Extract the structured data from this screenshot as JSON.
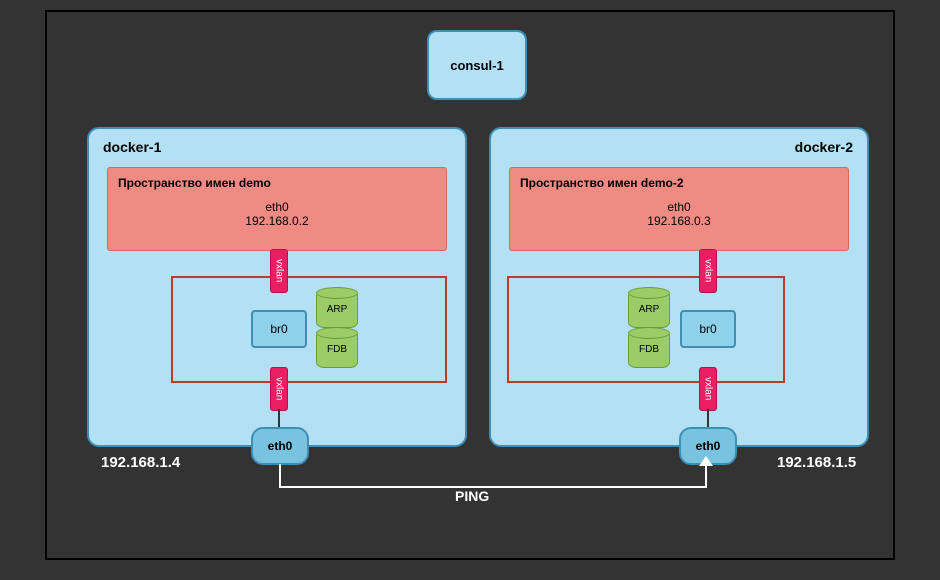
{
  "consul": {
    "label": "consul-1"
  },
  "docker1": {
    "title": "docker-1",
    "namespace": {
      "title": "Пространство имен demo",
      "iface": "eth0",
      "ip": "192.168.0.2"
    },
    "vxlan": "vxlan",
    "br0": "br0",
    "db": {
      "arp": "ARP",
      "fdb": "FDB"
    },
    "eth0": "eth0",
    "host_ip": "192.168.1.4"
  },
  "docker2": {
    "title": "docker-2",
    "namespace": {
      "title": "Пространство имен demo-2",
      "iface": "eth0",
      "ip": "192.168.0.3"
    },
    "vxlan": "vxlan",
    "br0": "br0",
    "db": {
      "arp": "ARP",
      "fdb": "FDB"
    },
    "eth0": "eth0",
    "host_ip": "192.168.1.5"
  },
  "ping": "PING"
}
